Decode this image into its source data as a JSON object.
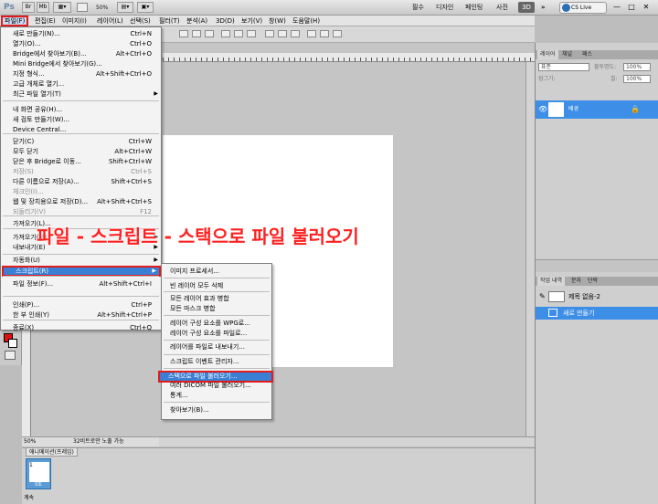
{
  "app": {
    "logo": "Ps"
  },
  "appbar": {
    "zoom": "50%",
    "workspaces": [
      "필수",
      "디자인",
      "페인팅",
      "사진"
    ],
    "badge_3d": "3D",
    "more": "»",
    "cslive": "CS Live",
    "win_buttons": [
      "—",
      "□",
      "✕"
    ]
  },
  "menubar": [
    "파일(F)",
    "편집(E)",
    "이미지(I)",
    "레이어(L)",
    "선택(S)",
    "필터(T)",
    "분석(A)",
    "3D(D)",
    "보기(V)",
    "창(W)",
    "도움말(H)"
  ],
  "file_menu": {
    "items": [
      {
        "label": "새로 만들기(N)...",
        "shortcut": "Ctrl+N"
      },
      {
        "label": "열기(O)...",
        "shortcut": "Ctrl+O"
      },
      {
        "label": "Bridge에서 찾아보기(B)...",
        "shortcut": "Alt+Ctrl+O"
      },
      {
        "label": "Mini Bridge에서 찾아보기(G)...",
        "shortcut": ""
      },
      {
        "label": "지정 형식...",
        "shortcut": "Alt+Shift+Ctrl+O"
      },
      {
        "label": "고급 개체로 열기...",
        "shortcut": ""
      },
      {
        "label": "최근 파일 열기(T)",
        "shortcut": "",
        "submenu": true
      },
      {
        "label": "내 화면 공유(H)...",
        "shortcut": ""
      },
      {
        "label": "새 검토 만들기(W)...",
        "shortcut": ""
      },
      {
        "label": "Device Central...",
        "shortcut": ""
      },
      {
        "label": "닫기(C)",
        "shortcut": "Ctrl+W"
      },
      {
        "label": "모두 닫기",
        "shortcut": "Alt+Ctrl+W"
      },
      {
        "label": "닫은 후 Bridge로 이동...",
        "shortcut": "Shift+Ctrl+W"
      },
      {
        "label": "저장(S)",
        "shortcut": "Ctrl+S",
        "disabled": true
      },
      {
        "label": "다른 이름으로 저장(A)...",
        "shortcut": "Shift+Ctrl+S"
      },
      {
        "label": "체크인(I)...",
        "shortcut": "",
        "disabled": true
      },
      {
        "label": "웹 및 장치용으로 저장(D)...",
        "shortcut": "Alt+Shift+Ctrl+S"
      },
      {
        "label": "되돌리기(V)",
        "shortcut": "F12",
        "disabled": true
      },
      {
        "label": "가져오기(L)...",
        "shortcut": ""
      },
      {
        "label": "가져오기(M)",
        "shortcut": "",
        "submenu": true
      },
      {
        "label": "내보내기(E)",
        "shortcut": "",
        "submenu": true
      },
      {
        "label": "자동화(U)",
        "shortcut": "",
        "submenu": true
      },
      {
        "label": "스크립트(R)",
        "shortcut": "",
        "submenu": true,
        "highlight": true
      },
      {
        "label": "파일 정보(F)...",
        "shortcut": "Alt+Shift+Ctrl+I"
      },
      {
        "label": "인쇄(P)...",
        "shortcut": "Ctrl+P"
      },
      {
        "label": "한 부 인쇄(Y)",
        "shortcut": "Alt+Shift+Ctrl+P"
      },
      {
        "label": "종료(X)",
        "shortcut": "Ctrl+Q"
      }
    ]
  },
  "script_submenu": {
    "items": [
      {
        "label": "이미지 프로세서..."
      },
      {
        "label": "빈 레이어 모두 삭제"
      },
      {
        "label": "모든 레이어 효과 병합"
      },
      {
        "label": "모든 마스크 병합"
      },
      {
        "label": "레이어 구성 요소를 WPG로..."
      },
      {
        "label": "레이어 구성 요소를 파일로..."
      },
      {
        "label": "레이어를 파일로 내보내기..."
      },
      {
        "label": "스크립트 이벤트 관리자..."
      },
      {
        "label": "스택으로 파일 불러오기...",
        "highlight": true
      },
      {
        "label": "여러 DICOM 파일 불러오기..."
      },
      {
        "label": "통계..."
      },
      {
        "label": "찾아보기(B)..."
      }
    ]
  },
  "caption": "파일 - 스크립트 - 스택으로 파일 불러오기",
  "status": {
    "zoom": "50%",
    "info": "32비트로만 노출 가능"
  },
  "animation": {
    "tabs": [
      "애니메이션(프레임)"
    ],
    "frame_number": "1",
    "frame_duration": "0초",
    "loop": "계속"
  },
  "layers_panel": {
    "tabs": [
      "레이어",
      "채널",
      "패스"
    ],
    "blend_mode": "표준",
    "opacity_label": "불투명도:",
    "opacity": "100%",
    "lock_label": "잠그기:",
    "fill_label": "칠:",
    "fill": "100%",
    "layer_name": "배경"
  },
  "history_panel": {
    "tabs": [
      "작업 내역",
      "문자",
      "단락"
    ],
    "snapshot": "제목 없음-2",
    "state": "새로 만들기"
  }
}
